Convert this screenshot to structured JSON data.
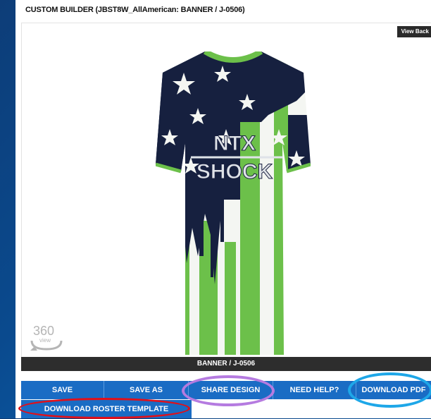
{
  "header": {
    "title": "CUSTOM BUILDER (JBST8W_AllAmerican: BANNER / J-0506)"
  },
  "stage": {
    "view_back_label": "View Back",
    "logo_line1": "NTX",
    "logo_line2": "SHOCK",
    "badge_360": "360",
    "badge_view": "view"
  },
  "caption": {
    "label": "BANNER / J-0506"
  },
  "actions": {
    "save": "SAVE",
    "save_as": "SAVE AS",
    "share_design": "SHARE DESIGN",
    "need_help": "NEED HELP?",
    "download_pdf": "DOWNLOAD PDF",
    "download_roster": "DOWNLOAD ROSTER TEMPLATE"
  },
  "colors": {
    "navy": "#16203f",
    "green": "#6cc04a",
    "button_blue": "#1a6cc4",
    "highlight_purple": "#b57be0",
    "highlight_cyan": "#1ea7e8",
    "highlight_red": "#e0101a"
  }
}
